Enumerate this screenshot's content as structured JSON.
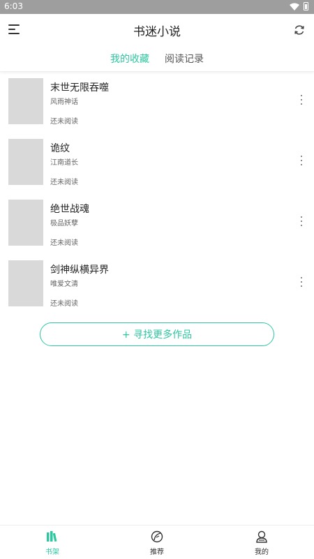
{
  "status": {
    "time": "6:03"
  },
  "header": {
    "title": "书迷小说"
  },
  "tabs": [
    {
      "label": "我的收藏",
      "active": true
    },
    {
      "label": "阅读记录",
      "active": false
    }
  ],
  "books": [
    {
      "title": "末世无限吞噬",
      "author": "风雨神话",
      "progress": "还未阅读"
    },
    {
      "title": "诡纹",
      "author": "江南道长",
      "progress": "还未阅读"
    },
    {
      "title": "绝世战魂",
      "author": "极品妖孽",
      "progress": "还未阅读"
    },
    {
      "title": "剑神纵横异界",
      "author": "唯爱文清",
      "progress": "还未阅读"
    }
  ],
  "find_more_label": "+ 寻找更多作品",
  "bottom_nav": [
    {
      "label": "书架",
      "icon": "bookshelf-icon",
      "active": true
    },
    {
      "label": "推荐",
      "icon": "recommend-leaf-icon",
      "active": false
    },
    {
      "label": "我的",
      "icon": "profile-icon",
      "active": false
    }
  ],
  "colors": {
    "accent": "#2dc7a0",
    "statusbar": "#9e9e9e",
    "cover_placeholder": "#d9d9d9"
  }
}
